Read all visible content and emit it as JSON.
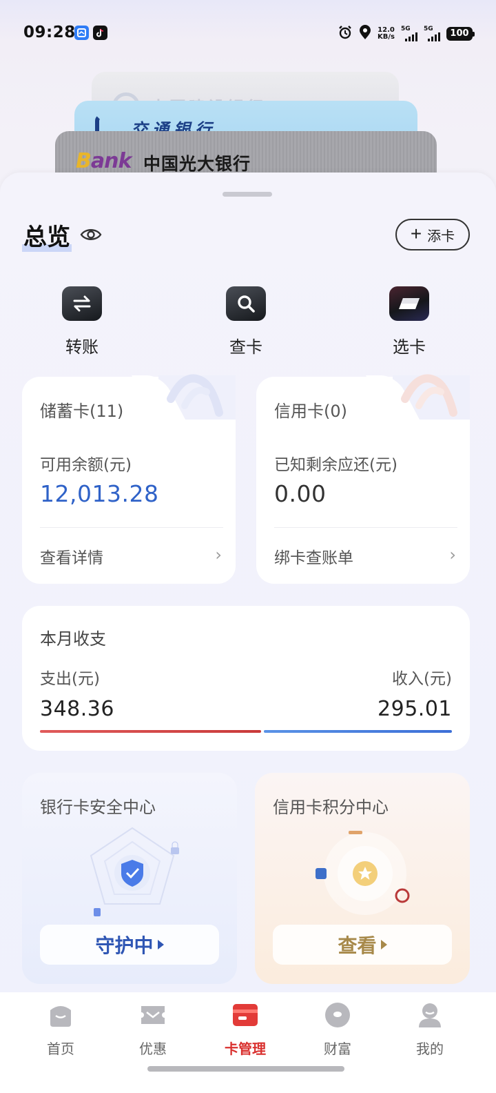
{
  "status_bar": {
    "time": "09:28",
    "net_speed_value": "12.0",
    "net_speed_unit": "KB/s",
    "sim1_tag": "5G",
    "sim2_tag": "5G",
    "battery": "100"
  },
  "card_stack": {
    "back_card": "中国建设银行",
    "middle_card": "交通银行",
    "front_card": "中国光大银行",
    "front_card_logo_b": "B",
    "front_card_logo_rest": "ank"
  },
  "overview": {
    "title": "总览",
    "add_card_label": "添卡"
  },
  "quick_actions": [
    {
      "label": "转账"
    },
    {
      "label": "查卡"
    },
    {
      "label": "选卡"
    }
  ],
  "debit": {
    "title": "储蓄卡(11)",
    "balance_label": "可用余额(元)",
    "balance_value": "12,013.28",
    "link_label": "查看详情"
  },
  "credit": {
    "title": "信用卡(0)",
    "balance_label": "已知剩余应还(元)",
    "balance_value": "0.00",
    "link_label": "绑卡查账单"
  },
  "monthly_flow": {
    "title": "本月收支",
    "expense_label": "支出(元)",
    "expense_value": "348.36",
    "income_label": "收入(元)",
    "income_value": "295.01",
    "expense_share": 0.541
  },
  "security_center": {
    "title": "银行卡安全中心",
    "button_label": "守护中"
  },
  "points_center": {
    "title": "信用卡积分中心",
    "button_label": "查看"
  },
  "tabbar": [
    {
      "label": "首页",
      "icon": "home-icon"
    },
    {
      "label": "优惠",
      "icon": "ticket-icon"
    },
    {
      "label": "卡管理",
      "icon": "card-icon",
      "active": true
    },
    {
      "label": "财富",
      "icon": "wealth-icon"
    },
    {
      "label": "我的",
      "icon": "profile-icon"
    }
  ],
  "colors": {
    "accent_blue": "#2f62c8",
    "active_red": "#d9302e",
    "expense_red": "#d24545",
    "income_blue": "#3c6fd7"
  }
}
